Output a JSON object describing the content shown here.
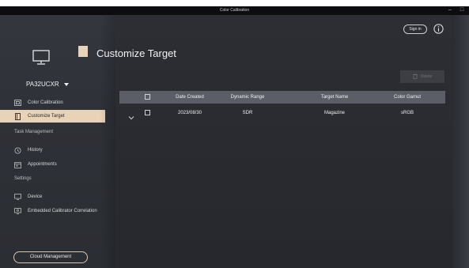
{
  "window": {
    "title": "Color Calibration",
    "minimize_glyph": "–",
    "maximize_glyph": "□"
  },
  "colors": {
    "accent": "#e8d2b8",
    "header_row": "#5b5e67",
    "background": "#2e3036"
  },
  "device": {
    "model": "PA32UCXR",
    "icon": "monitor-icon"
  },
  "sidebar": {
    "items_top": [
      {
        "label": "Color Calibration",
        "icon": "calibration-icon",
        "active": false
      },
      {
        "label": "Customize Target",
        "icon": "target-doc-icon",
        "active": true
      }
    ],
    "task_section": "Task Management",
    "task_items": [
      {
        "label": "History",
        "icon": "history-icon"
      },
      {
        "label": "Appointments",
        "icon": "calendar-icon"
      }
    ],
    "settings_section": "Settings",
    "settings_items": [
      {
        "label": "Device",
        "icon": "device-icon"
      },
      {
        "label": "Embedded Calibrator Correlation",
        "icon": "calibrator-icon"
      }
    ],
    "cloud_button": "Cloud Management"
  },
  "header": {
    "title": "Customize Target",
    "sign_in": "Sign in",
    "info_icon": "info-icon"
  },
  "toolbar": {
    "delete_label": "Delete",
    "delete_icon": "trash-icon"
  },
  "table": {
    "columns": [
      "Date Created",
      "Dynamic Range",
      "Target Name",
      "Color Gamut"
    ],
    "rows": [
      {
        "date": "2023/08/30",
        "range": "SDR",
        "name": "Magazine",
        "gamut": "sRGB",
        "checked": false
      }
    ]
  }
}
